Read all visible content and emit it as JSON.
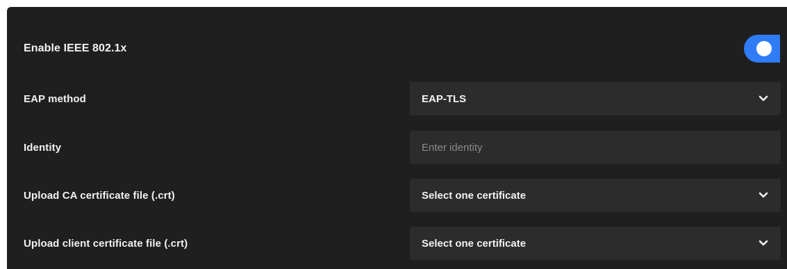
{
  "header": {
    "label": "Enable IEEE 802.1x",
    "toggle_state": "on",
    "toggle_color": "#2f7cf6"
  },
  "eap_method": {
    "label": "EAP method",
    "value": "EAP-TLS"
  },
  "identity": {
    "label": "Identity",
    "placeholder": "Enter identity",
    "value": ""
  },
  "ca_certificate": {
    "label": "Upload CA certificate file (.crt)",
    "value": "Select one certificate"
  },
  "client_certificate": {
    "label": "Upload client certificate file (.crt)",
    "value": "Select one certificate"
  },
  "icons": {
    "dropdown": "chevron-down-icon"
  },
  "colors": {
    "panel_background": "#1f1f1f",
    "field_background": "#2c2c2c",
    "text": "#f2f2f2",
    "placeholder": "#8a8a8a",
    "accent": "#2f7cf6"
  }
}
